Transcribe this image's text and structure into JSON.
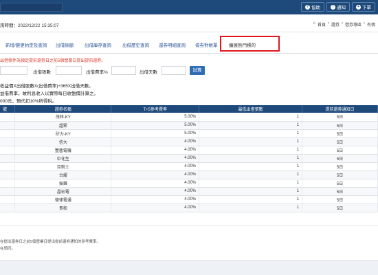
{
  "topbar": {
    "buttons": [
      {
        "label": "協助",
        "icon": "question-icon"
      },
      {
        "label": "通知",
        "icon": "bell-icon"
      },
      {
        "label": "下單",
        "icon": "order-icon"
      }
    ]
  },
  "header": {
    "time": "詢時間：2022/12/22 15:35:07",
    "breadcrumb": [
      "首頁",
      "證券",
      "借券專區",
      "有價"
    ]
  },
  "tabs": [
    {
      "label": "新增/變更約定及查詢"
    },
    {
      "label": "出借餘額"
    },
    {
      "label": "出借庫存查詢"
    },
    {
      "label": "出借歷史查詢"
    },
    {
      "label": "還券明細查詢"
    },
    {
      "label": "借券對帳單"
    },
    {
      "label": "擴展熱門標的",
      "active": true
    }
  ],
  "warning": "出借條件為預定提前還券日之前5個營業日提出提前還券。",
  "filters": {
    "labels": [
      "出借張數",
      "出借費率%",
      "出借天數"
    ],
    "unit": "%",
    "submit": "試算"
  },
  "notes": [
    "收益價X出借股數X(出借費率)÷365X出借天數。",
    "益借費率，故利息收入以實際每日收盤價計算之。",
    "000元，預代扣10%所得稅。"
  ],
  "table": {
    "headers": [
      "號",
      "證券名稱",
      "T+5參考費率",
      "最低出借張數",
      "提前還券通知日"
    ],
    "rows": [
      {
        "name": "茂林-KY",
        "rate": "5.00%",
        "min": "1",
        "notice": "5日"
      },
      {
        "name": "超眾",
        "rate": "5.00%",
        "min": "1",
        "notice": "5日"
      },
      {
        "name": "矽力-KY",
        "rate": "5.00%",
        "min": "1",
        "notice": "5日"
      },
      {
        "name": "信大",
        "rate": "4.00%",
        "min": "1",
        "notice": "5日"
      },
      {
        "name": "豐藝電機",
        "rate": "4.00%",
        "min": "1",
        "notice": "5日"
      },
      {
        "name": "中化生",
        "rate": "4.00%",
        "min": "1",
        "notice": "5日"
      },
      {
        "name": "亞銳士",
        "rate": "4.00%",
        "min": "1",
        "notice": "5日"
      },
      {
        "name": "台燿",
        "rate": "4.00%",
        "min": "1",
        "notice": "5日"
      },
      {
        "name": "振鋒",
        "rate": "4.00%",
        "min": "1",
        "notice": "5日"
      },
      {
        "name": "晶宏電",
        "rate": "4.00%",
        "min": "1",
        "notice": "5日"
      },
      {
        "name": "德律電通",
        "rate": "4.00%",
        "min": "1",
        "notice": "5日"
      },
      {
        "name": "貴和",
        "rate": "4.00%",
        "min": "1",
        "notice": "5日"
      }
    ]
  },
  "footnotes": [
    "在提出還券日之前5個營業日提出提前還券通知的參考費率。",
    "在頭同。"
  ]
}
